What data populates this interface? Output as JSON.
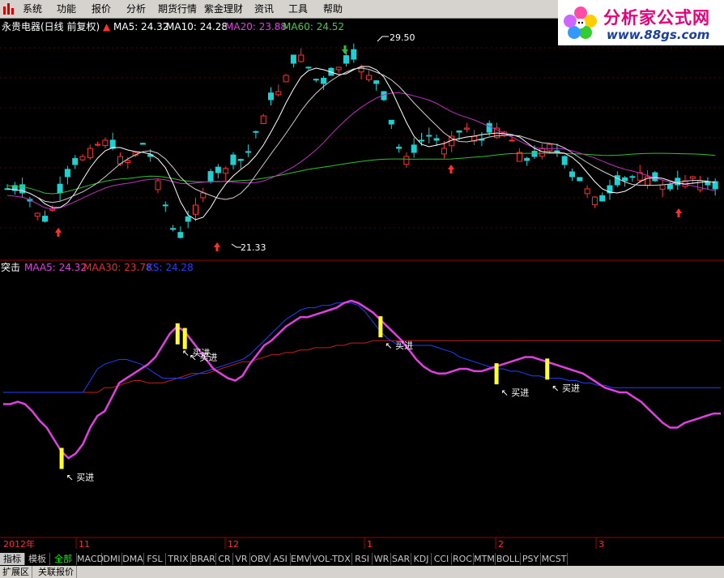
{
  "menu": {
    "items": [
      "系统",
      "功能",
      "报价",
      "分析",
      "期货行情",
      "紫金理财",
      "资讯",
      "工具",
      "帮助"
    ]
  },
  "brand": {
    "title": "分析家公式网",
    "url": "www.88gs.com"
  },
  "main_chart": {
    "stock": "永贵电器(日线 前复权)",
    "ma": [
      {
        "label": "MA5: 24.32",
        "color": "#ffffff"
      },
      {
        "label": "MA10: 24.28",
        "color": "#ffffff"
      },
      {
        "label": "MA20: 23.88",
        "color": "#e040e0"
      },
      {
        "label": "MA60: 24.52",
        "color": "#40d040"
      }
    ],
    "high_label": "29.50",
    "low_label": "21.33"
  },
  "indicator": {
    "name": "突击",
    "lines": [
      {
        "label": "MAA5: 24.32",
        "color": "#e040e0"
      },
      {
        "label": "MAA30: 23.78",
        "color": "#e03030"
      },
      {
        "label": "KS: 24.28",
        "color": "#2040ff"
      }
    ],
    "signal_label": "买进"
  },
  "chart_data": {
    "type": "line",
    "x": [
      0,
      1,
      2,
      3,
      4,
      5,
      6,
      7,
      8,
      9,
      10,
      11,
      12,
      13,
      14,
      15,
      16,
      17,
      18,
      19,
      20,
      21,
      22,
      23,
      24,
      25,
      26,
      27,
      28,
      29,
      30,
      31,
      32,
      33,
      34,
      35,
      36,
      37,
      38,
      39,
      40,
      41,
      42,
      43,
      44,
      45,
      46,
      47,
      48,
      49,
      50,
      51,
      52,
      53,
      54,
      55,
      56,
      57,
      58,
      59,
      60,
      61,
      62,
      63,
      64,
      65,
      66,
      67,
      68,
      69,
      70,
      71,
      72,
      73,
      74,
      75,
      76,
      77,
      78,
      79,
      80,
      81,
      82,
      83,
      84,
      85,
      86,
      87,
      88,
      89,
      90,
      91,
      92,
      93,
      94,
      95,
      96,
      97,
      98,
      99
    ],
    "series": [
      {
        "name": "MAA5",
        "color": "#e040e0",
        "values": [
          55,
          55,
          56,
          55,
          52,
          48,
          45,
          40,
          35,
          32,
          34,
          38,
          45,
          50,
          52,
          58,
          64,
          66,
          68,
          70,
          72,
          75,
          80,
          85,
          88,
          86,
          82,
          78,
          74,
          70,
          68,
          66,
          65,
          67,
          72,
          76,
          80,
          82,
          85,
          88,
          90,
          92,
          92,
          93,
          94,
          95,
          96,
          98,
          99,
          98,
          96,
          94,
          91,
          88,
          85,
          82,
          78,
          74,
          71,
          69,
          68,
          68,
          69,
          70,
          70,
          69,
          69,
          70,
          71,
          72,
          73,
          74,
          75,
          75,
          74,
          73,
          72,
          71,
          70,
          69,
          68,
          66,
          64,
          62,
          61,
          60,
          60,
          58,
          56,
          53,
          50,
          47,
          45,
          45,
          47,
          48,
          49,
          50,
          51,
          51
        ]
      },
      {
        "name": "MAA30",
        "color": "#e03030",
        "values": [
          60,
          60,
          60,
          60,
          60,
          60,
          60,
          60,
          60,
          60,
          60,
          60,
          60,
          60,
          62,
          62,
          63,
          64,
          65,
          65,
          64,
          64,
          64,
          65,
          66,
          67,
          68,
          68,
          68,
          69,
          70,
          71,
          72,
          73,
          73,
          74,
          75,
          76,
          76,
          77,
          77,
          78,
          78,
          79,
          79,
          79,
          80,
          80,
          81,
          81,
          81,
          82,
          82,
          82,
          82,
          82,
          82,
          82,
          82,
          82,
          82,
          82,
          82,
          82,
          82,
          82,
          82,
          82,
          82,
          82,
          82,
          82,
          82,
          82,
          82,
          82,
          82,
          82,
          82,
          82,
          82,
          82,
          82,
          82,
          82,
          82,
          82,
          82,
          82,
          82,
          82,
          82,
          82,
          82,
          82,
          82,
          82,
          82,
          82,
          82
        ]
      },
      {
        "name": "KS",
        "color": "#2040ff",
        "values": [
          60,
          60,
          60,
          60,
          60,
          60,
          60,
          60,
          60,
          60,
          60,
          60,
          65,
          70,
          72,
          73,
          74,
          74,
          73,
          72,
          70,
          68,
          66,
          66,
          66,
          66,
          67,
          68,
          69,
          70,
          71,
          72,
          73,
          74,
          76,
          79,
          82,
          85,
          88,
          91,
          93,
          95,
          96,
          96,
          97,
          97,
          98,
          98,
          98,
          97,
          94,
          90,
          86,
          83,
          81,
          80,
          80,
          80,
          80,
          80,
          79,
          78,
          77,
          75,
          74,
          73,
          72,
          71,
          70,
          70,
          69,
          69,
          68,
          67,
          67,
          66,
          66,
          66,
          65,
          65,
          64,
          64,
          63,
          63,
          62,
          62,
          62,
          62,
          62,
          62,
          62,
          62,
          62,
          62,
          62,
          62,
          62,
          62,
          62,
          62
        ]
      }
    ],
    "buy_signals": [
      {
        "x": 8,
        "text": "买进"
      },
      {
        "x": 24,
        "text": "买进"
      },
      {
        "x": 25,
        "text": "买进"
      },
      {
        "x": 52,
        "text": "买进"
      },
      {
        "x": 68,
        "text": "买进"
      },
      {
        "x": 75,
        "text": "买进"
      }
    ]
  },
  "time_axis": {
    "labels": [
      {
        "text": "2012年",
        "col": "year"
      },
      {
        "text": "11",
        "col": "nov"
      },
      {
        "text": "12",
        "col": "dec"
      },
      {
        "text": "1",
        "col": "jan"
      },
      {
        "text": "2",
        "col": "feb"
      },
      {
        "text": "3",
        "col": "mar"
      }
    ]
  },
  "tabs": {
    "items": [
      "指标",
      "模板",
      "全部",
      "MACD",
      "DMI",
      "DMA",
      "FSL",
      "TRIX",
      "BRAR",
      "CR",
      "VR",
      "OBV",
      "ASI",
      "EMV",
      "VOL-TDX",
      "RSI",
      "WR",
      "SAR",
      "KDJ",
      "CCI",
      "ROC",
      "MTM",
      "BOLL",
      "PSY",
      "MCST"
    ]
  },
  "status_bar": {
    "items": [
      "扩展区",
      "关联报价"
    ]
  }
}
